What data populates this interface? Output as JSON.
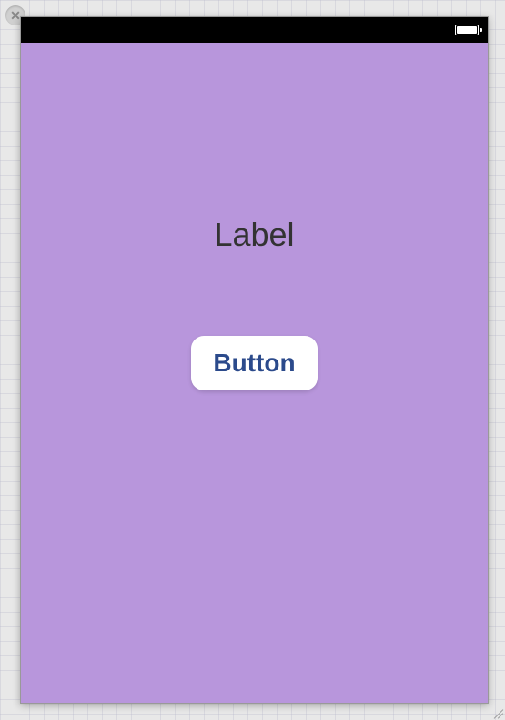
{
  "canvas": {
    "close_symbol": "✕"
  },
  "view": {
    "background_color": "#b896dc",
    "label_text": "Label",
    "button_label": "Button"
  },
  "status_bar": {
    "battery_icon": "battery-full"
  }
}
